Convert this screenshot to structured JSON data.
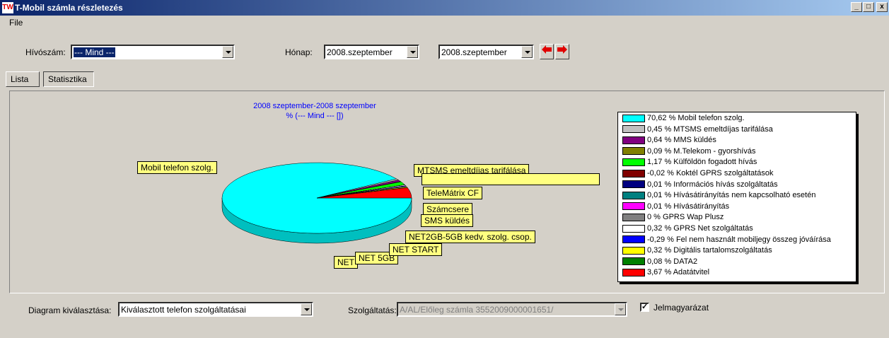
{
  "window": {
    "title": "T-Mobil számla részletezés",
    "icon_text": "TW",
    "minimize_glyph": "_",
    "maximize_glyph": "□",
    "close_glyph": "x"
  },
  "menu": {
    "file_label": "File"
  },
  "filters": {
    "phone_label": "Hívószám:",
    "phone_value": "--- Mind ---",
    "month_label": "Hónap:",
    "month_from": "2008.szeptember",
    "month_to": "2008.szeptember",
    "prev_icon": "arrow-left-icon",
    "next_icon": "arrow-right-icon"
  },
  "tabs": {
    "list_label": "Lista",
    "stats_label": "Statisztika",
    "active": "Statisztika"
  },
  "chart_heading": {
    "line1": "2008 szeptember-2008 szeptember",
    "line2": "% (--- Mind --- [])"
  },
  "chart_data": {
    "type": "pie",
    "title": "2008 szeptember-2008 szeptember",
    "subtitle": "% (--- Mind --- [])",
    "legend_placement": "right",
    "series": [
      {
        "name": "Mobil telefon szolg.",
        "value": 70.62,
        "color": "#00ffff"
      },
      {
        "name": "MTSMS emeltdíjas tarifálása",
        "value": 0.45,
        "color": "#c0c0c0"
      },
      {
        "name": "MMS küldés",
        "value": 0.64,
        "color": "#800080"
      },
      {
        "name": "M.Telekom - gyorshívás",
        "value": 0.09,
        "color": "#808000"
      },
      {
        "name": "Külföldön fogadott hívás",
        "value": 1.17,
        "color": "#00ff00"
      },
      {
        "name": "Koktél GPRS szolgáltatások",
        "value": -0.02,
        "color": "#800000"
      },
      {
        "name": "Információs hívás szolgáltatás",
        "value": 0.01,
        "color": "#000080"
      },
      {
        "name": "Hívásátirányítás nem kapcsolható esetén",
        "value": 0.01,
        "color": "#008080"
      },
      {
        "name": "Hívásátirányítás",
        "value": 0.01,
        "color": "#ff00ff"
      },
      {
        "name": "GPRS Wap Plusz",
        "value": 0,
        "color": "#808080"
      },
      {
        "name": "GPRS Net szolgáltatás",
        "value": 0.32,
        "color": "#ffffff"
      },
      {
        "name": "Fel nem használt mobiljegy összeg jóváírása",
        "value": -0.29,
        "color": "#0000ff"
      },
      {
        "name": "Digitális tartalomszolgáltatás",
        "value": 0.32,
        "color": "#ffff00"
      },
      {
        "name": "DATA2",
        "value": 0.08,
        "color": "#008000"
      },
      {
        "name": "Adatátvitel",
        "value": 3.67,
        "color": "#ff0000"
      }
    ],
    "legend_entries": [
      "70,62 % Mobil telefon szolg.",
      "0,45 % MTSMS emeltdíjas tarifálása",
      "0,64 % MMS küldés",
      "0,09 % M.Telekom - gyorshívás",
      "1,17 % Külföldön fogadott hívás",
      "-0,02 % Koktél GPRS szolgáltatások",
      "0,01 % Információs hívás szolgáltatás",
      "0,01 % Hívásátirányítás nem kapcsolható esetén",
      "0,01 % Hívásátirányítás",
      "0 % GPRS Wap Plusz",
      "0,32 % GPRS Net szolgáltatás",
      "-0,29 % Fel nem használt mobiljegy összeg jóváírása",
      "0,32 % Digitális tartalomszolgáltatás",
      "0,08 % DATA2",
      "3,67 % Adatátvitel"
    ],
    "callouts": [
      "Mobil telefon szolg.",
      "MTSMS emeltdíjas tarifálása",
      "TeleMátrix CF",
      "Számcsere",
      "SMS küldés",
      "NET2GB-5GB kedv. szolg. csop.",
      "NET START",
      "NET 5GB",
      "NET"
    ]
  },
  "bottom": {
    "diagram_label": "Diagram kiválasztása:",
    "diagram_value": "Kiválasztott telefon szolgáltatásai",
    "service_label": "Szolgáltatás:",
    "service_value": "A/AL/Előleg számla 3552009000001651/",
    "legend_checkbox_label": "Jelmagyarázat",
    "legend_checked": true
  }
}
